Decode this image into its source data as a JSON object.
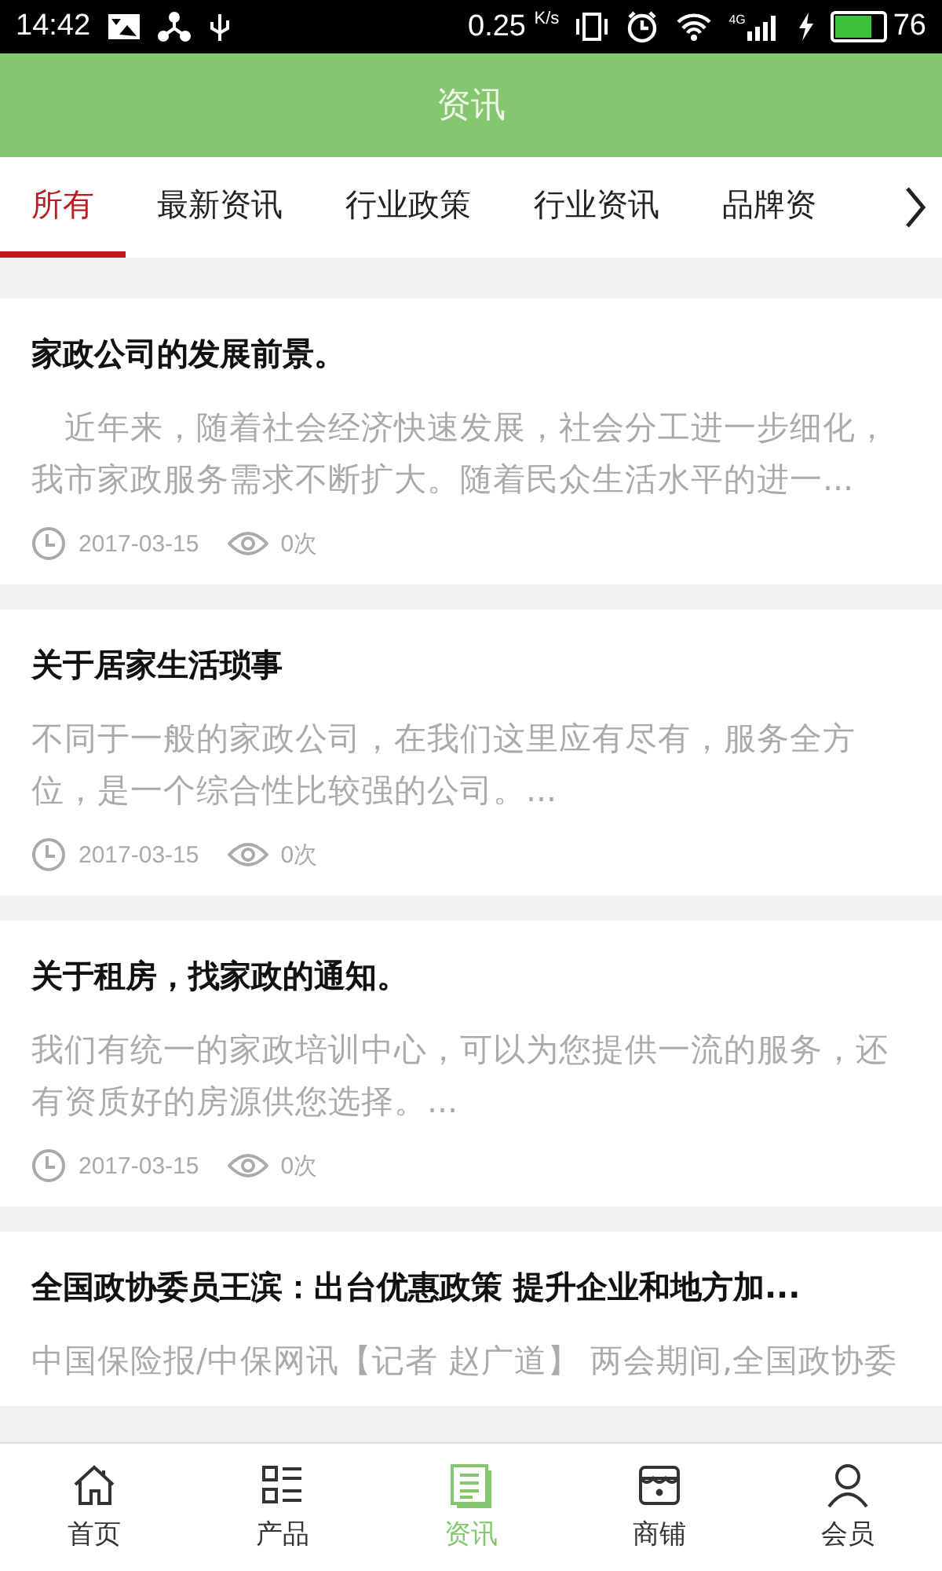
{
  "status_bar": {
    "time": "14:42",
    "speed": "0.25",
    "speed_unit": "K/s",
    "network": "4G",
    "battery": "76"
  },
  "header": {
    "title": "资讯"
  },
  "tabs": [
    {
      "label": "所有",
      "selected": true
    },
    {
      "label": "最新资讯",
      "selected": false
    },
    {
      "label": "行业政策",
      "selected": false
    },
    {
      "label": "行业资讯",
      "selected": false
    },
    {
      "label": "品牌资",
      "selected": false
    }
  ],
  "articles": [
    {
      "title": "家政公司的发展前景。",
      "summary_lines": [
        "　近年来，随着社会经济快速发展，社会分工进一步细化，",
        "我市家政服务需求不断扩大。随着民众生活水平的进一..."
      ],
      "date": "2017-03-15",
      "views": "0次"
    },
    {
      "title": "关于居家生活琐事",
      "summary_lines": [
        "不同于一般的家政公司，在我们这里应有尽有，服务全方",
        "位，是一个综合性比较强的公司。..."
      ],
      "date": "2017-03-15",
      "views": "0次"
    },
    {
      "title": "关于租房，找家政的通知。",
      "summary_lines": [
        "我们有统一的家政培训中心，可以为您提供一流的服务，还",
        "有资质好的房源供您选择。..."
      ],
      "date": "2017-03-15",
      "views": "0次"
    },
    {
      "title": "全国政协委员王滨：出台优惠政策 提升企业和地方加...",
      "summary_lines": [
        "中国保险报/中保网讯【记者 赵广道】 两会期间,全国政协委"
      ]
    }
  ],
  "bottom_nav": [
    {
      "label": "首页",
      "kind": "home",
      "selected": false
    },
    {
      "label": "产品",
      "kind": "products",
      "selected": false
    },
    {
      "label": "资讯",
      "kind": "news",
      "selected": true
    },
    {
      "label": "商铺",
      "kind": "shop",
      "selected": false
    },
    {
      "label": "会员",
      "kind": "member",
      "selected": false
    }
  ]
}
